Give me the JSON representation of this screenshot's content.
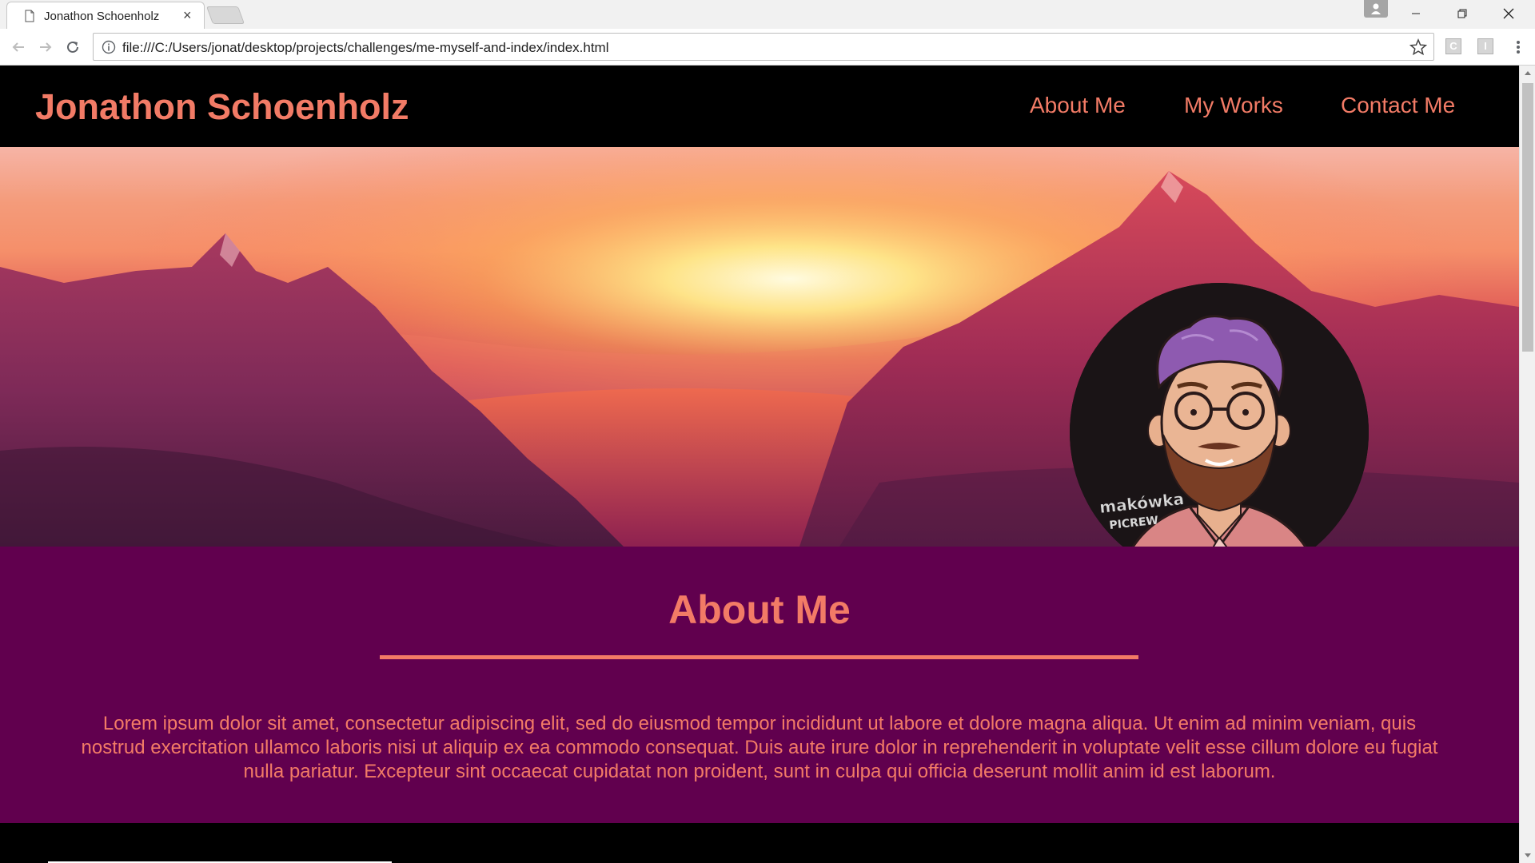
{
  "browser": {
    "tab_title": "Jonathon Schoenholz",
    "tab_close": "×",
    "url": "file:///C:/Users/jonat/desktop/projects/challenges/me-myself-and-index/index.html",
    "extensions": [
      "C",
      "I"
    ]
  },
  "site": {
    "brand": "Jonathon Schoenholz",
    "nav": [
      "About Me",
      "My Works",
      "Contact Me"
    ],
    "avatar_watermark": [
      "makówka",
      "PICREW"
    ]
  },
  "about": {
    "title": "About Me",
    "body": "Lorem ipsum dolor sit amet, consectetur adipiscing elit, sed do eiusmod tempor incididunt ut labore et dolore magna aliqua. Ut enim ad minim veniam, quis nostrud exercitation ullamco laboris nisi ut aliquip ex ea commodo consequat. Duis aute irure dolor in reprehenderit in voluptate velit esse cillum dolore eu fugiat nulla pariatur. Excepteur sint occaecat cupidatat non proident, sunt in culpa qui officia deserunt mollit anim id est laborum."
  },
  "colors": {
    "accent": "#f27b66",
    "header_bg": "#000000",
    "about_bg": "#61004e"
  },
  "icons": [
    "document-icon",
    "close-icon",
    "back-icon",
    "forward-icon",
    "reload-icon",
    "info-icon",
    "star-icon",
    "menu-icon",
    "profile-icon",
    "minimize-icon",
    "maximize-icon",
    "window-close-icon"
  ]
}
